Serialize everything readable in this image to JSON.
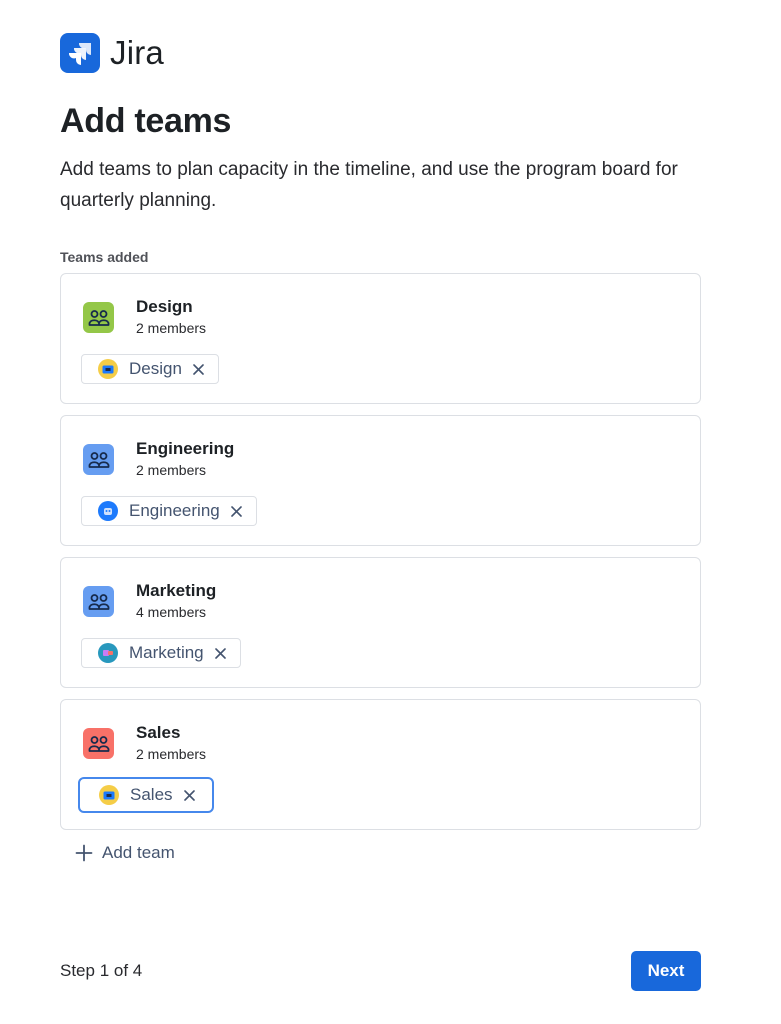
{
  "app": {
    "name": "Jira",
    "brand_color": "#1868db",
    "logo_icon": "jira-logo-icon"
  },
  "page": {
    "title": "Add teams",
    "description": "Add teams to plan capacity in the timeline, and use the program board for quarterly planning."
  },
  "teams_section": {
    "label": "Teams added",
    "teams": [
      {
        "name": "Design",
        "members": "2 members",
        "tag_label": "Design",
        "avatar_color": "#94c748",
        "tag_icon": "design-team-icon",
        "focused": false
      },
      {
        "name": "Engineering",
        "members": "2 members",
        "tag_label": "Engineering",
        "avatar_color": "#669df1",
        "tag_icon": "engineering-team-icon",
        "focused": false
      },
      {
        "name": "Marketing",
        "members": "4 members",
        "tag_label": "Marketing",
        "avatar_color": "#669df1",
        "tag_icon": "marketing-team-icon",
        "focused": false
      },
      {
        "name": "Sales",
        "members": "2 members",
        "tag_label": "Sales",
        "avatar_color": "#f87168",
        "tag_icon": "sales-team-icon",
        "focused": true
      }
    ],
    "add_label": "Add team"
  },
  "footer": {
    "step_text": "Step 1 of 4",
    "next_label": "Next"
  }
}
